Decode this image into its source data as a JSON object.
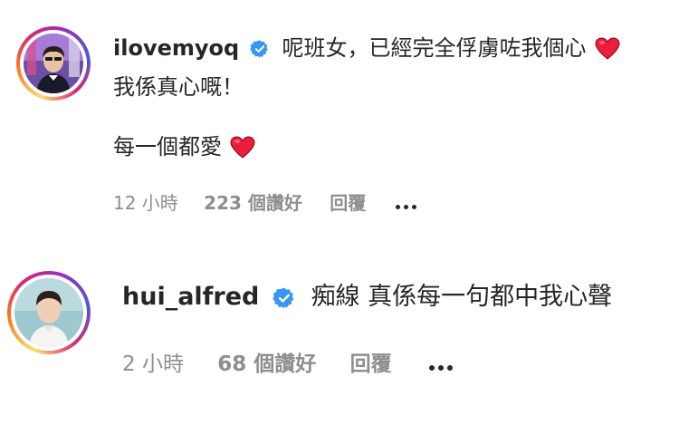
{
  "comments": [
    {
      "username": "ilovemyoq",
      "verified": true,
      "lines": [
        "呢班女，已經完全俘虜咗我個心",
        "我係真心嘅！",
        "每一個都愛"
      ],
      "time": "12 小時",
      "likes": "223 個讚好",
      "reply": "回覆"
    },
    {
      "username": "hui_alfred",
      "verified": true,
      "lines": [
        "痴線 真係每一句都中我心聲"
      ],
      "time": "2 小時",
      "likes": "68 個讚好",
      "reply": "回覆"
    }
  ],
  "colors": {
    "verified_badge": "#3897f0",
    "heart": "#ed1c3b",
    "secondary_text": "#8e8e8e",
    "primary_text": "#262626"
  },
  "icons": [
    "verified-badge-icon",
    "red-heart-icon",
    "more-options-icon"
  ]
}
